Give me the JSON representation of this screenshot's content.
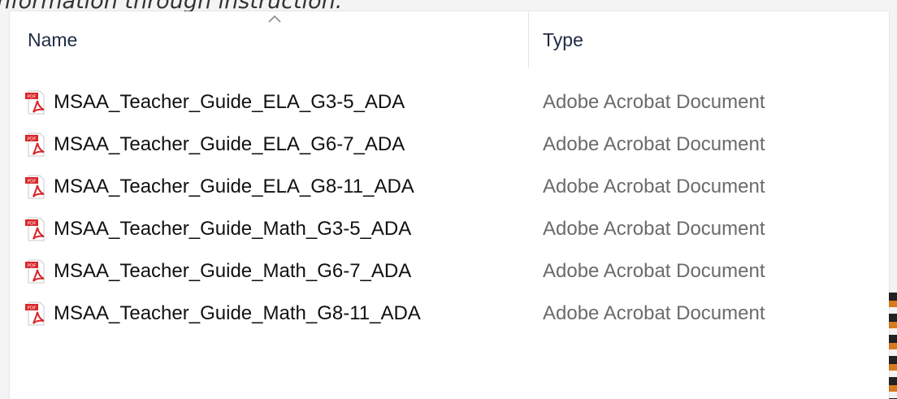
{
  "background": {
    "doc_text": "nformation through instruction."
  },
  "header": {
    "name_label": "Name",
    "type_label": "Type",
    "sort_icon": "chevron-up-icon"
  },
  "files": [
    {
      "name": "MSAA_Teacher_Guide_ELA_G3-5_ADA",
      "type": "Adobe Acrobat Document",
      "icon": "pdf-icon"
    },
    {
      "name": "MSAA_Teacher_Guide_ELA_G6-7_ADA",
      "type": "Adobe Acrobat Document",
      "icon": "pdf-icon"
    },
    {
      "name": "MSAA_Teacher_Guide_ELA_G8-11_ADA",
      "type": "Adobe Acrobat Document",
      "icon": "pdf-icon"
    },
    {
      "name": "MSAA_Teacher_Guide_Math_G3-5_ADA",
      "type": "Adobe Acrobat Document",
      "icon": "pdf-icon"
    },
    {
      "name": "MSAA_Teacher_Guide_Math_G6-7_ADA",
      "type": "Adobe Acrobat Document",
      "icon": "pdf-icon"
    },
    {
      "name": "MSAA_Teacher_Guide_Math_G8-11_ADA",
      "type": "Adobe Acrobat Document",
      "icon": "pdf-icon"
    }
  ],
  "colors": {
    "pdf_red": "#d9262a",
    "type_text": "#6b6b6b",
    "header_text": "#1f2a44"
  }
}
